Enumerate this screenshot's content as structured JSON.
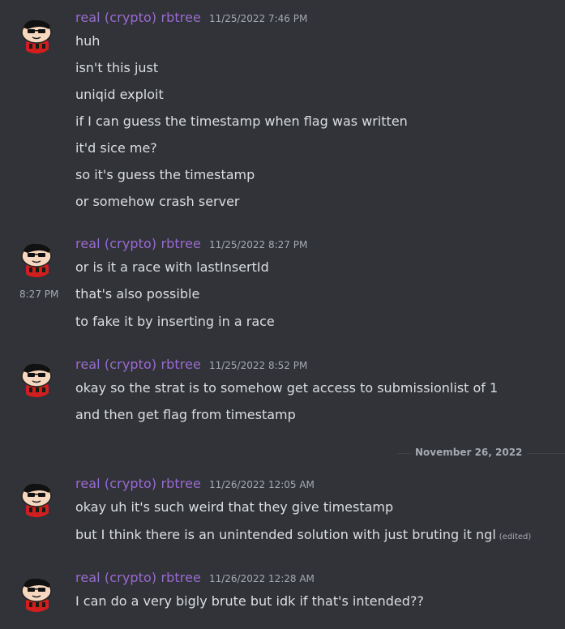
{
  "messages": [
    {
      "username": "real (crypto) rbtree",
      "timestamp": "11/25/2022 7:46 PM",
      "lines": [
        "huh",
        "isn't this just",
        "uniqid exploit",
        "if I can guess the timestamp when flag was written",
        "it'd sice me?",
        "so it's guess the timestamp",
        "or somehow crash server"
      ]
    },
    {
      "username": "real (crypto) rbtree",
      "timestamp": "11/25/2022 8:27 PM",
      "lines": [
        "or is it a race with lastInsertId",
        "that's also possible",
        "to fake it by inserting in a race"
      ],
      "hover_time": "8:27 PM"
    },
    {
      "username": "real (crypto) rbtree",
      "timestamp": "11/25/2022 8:52 PM",
      "lines": [
        "okay so the strat is to somehow get access to submissionlist of 1",
        "and then get flag from timestamp"
      ]
    },
    {
      "username": "real (crypto) rbtree",
      "timestamp": "11/26/2022 12:05 AM",
      "lines": [
        "okay uh it's such weird that they give timestamp",
        "but I think there is an unintended solution with just bruting it ngl"
      ],
      "edited": "(edited)"
    },
    {
      "username": "real (crypto) rbtree",
      "timestamp": "11/26/2022 12:28 AM",
      "lines": [
        "I can do a very bigly brute but idk if that's intended??"
      ]
    }
  ],
  "date_divider": "November 26, 2022",
  "colors": {
    "background": "#313338",
    "username": "#9b6ad3",
    "text": "#dbdee1",
    "muted": "#a5a9b1"
  },
  "avatar_icon": "shinchan-sunglasses-avatar"
}
